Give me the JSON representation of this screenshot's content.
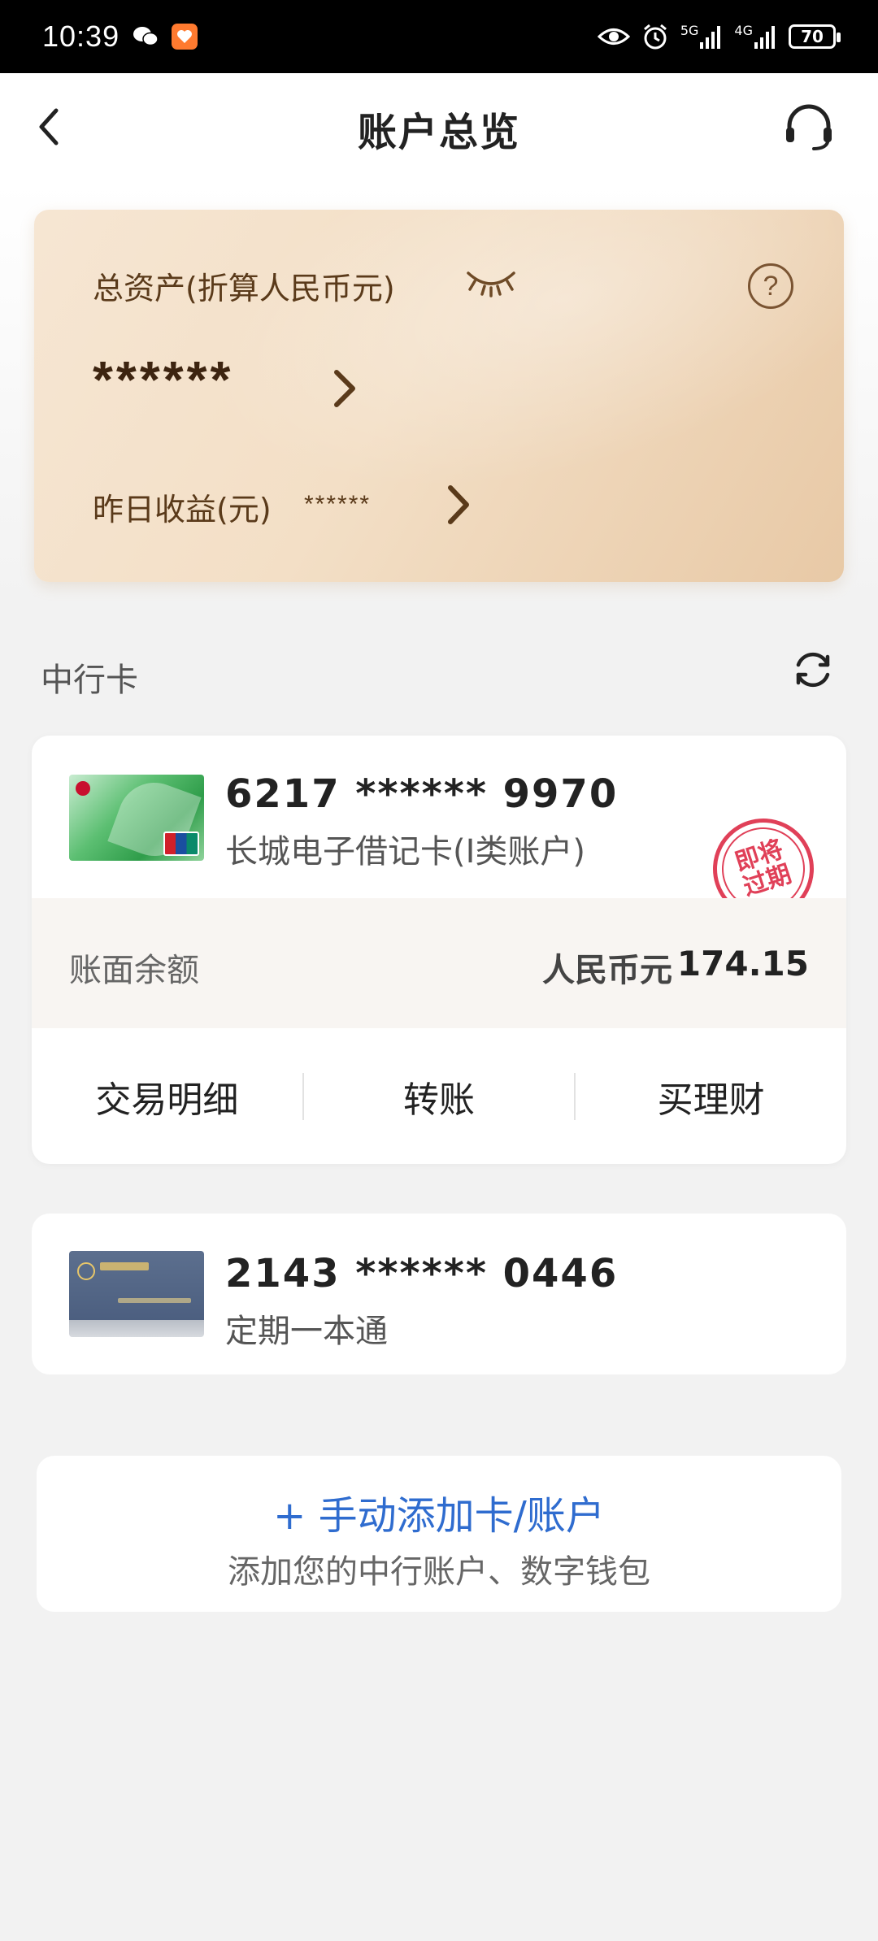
{
  "status_bar": {
    "time": "10:39",
    "signal1_label": "5G",
    "signal2_label": "4G",
    "battery": "70"
  },
  "header": {
    "title": "账户总览"
  },
  "asset_card": {
    "label": "总资产(折算人民币元)",
    "amount": "******",
    "yesterday_label": "昨日收益(元)",
    "yesterday_value": "******",
    "help_symbol": "?"
  },
  "section": {
    "title": "中行卡"
  },
  "cards": [
    {
      "number": "6217 ****** 9970",
      "type": "长城电子借记卡(I类账户)",
      "stamp": "即将过期",
      "balance_label": "账面余额",
      "balance_currency": "人民币元",
      "balance_amount": "174.15",
      "actions": [
        "交易明细",
        "转账",
        "买理财"
      ]
    },
    {
      "number": "2143 ****** 0446",
      "type": "定期一本通"
    }
  ],
  "add_card": {
    "title": "+ 手动添加卡/账户",
    "subtitle": "添加您的中行账户、数字钱包"
  },
  "colors": {
    "accent_blue": "#2f6ccf",
    "asset_brown": "#5a3a1a",
    "stamp_red": "#e04058"
  }
}
